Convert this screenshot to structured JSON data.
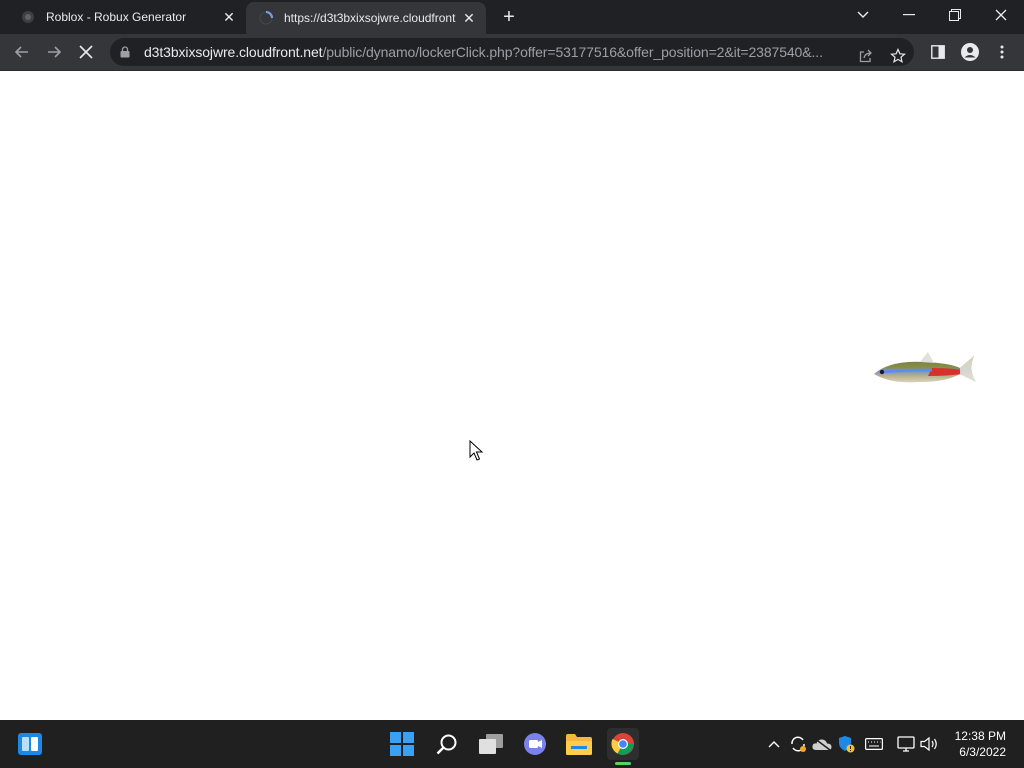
{
  "tabs": [
    {
      "title": "Roblox - Robux Generator",
      "active": false,
      "favicon": "roblox-icon"
    },
    {
      "title": "https://d3t3bxixsojwre.cloudfront",
      "active": true,
      "favicon": "loading-spinner-icon"
    }
  ],
  "address_bar": {
    "host": "d3t3bxixsojwre.cloudfront.net",
    "path": "/public/dynamo/lockerClick.php?offer=53177516&offer_position=2&it=2387540&..."
  },
  "page": {
    "image": "neon-tetra-fish"
  },
  "taskbar": {
    "apps": [
      "start-icon",
      "search-icon",
      "task-view-icon",
      "teams-chat-icon",
      "file-explorer-icon",
      "chrome-icon"
    ],
    "active_app": "chrome-icon",
    "tray_icons": [
      "chevron-up-icon",
      "sync-icon",
      "onedrive-icon",
      "defender-icon",
      "keyboard-icon",
      "network-icon",
      "volume-icon"
    ],
    "time": "12:38 PM",
    "date": "6/3/2022"
  },
  "colors": {
    "tabbar": "#202124",
    "active_tab": "#35363a",
    "taskbar": "#202020",
    "accent": "#0078d4"
  }
}
